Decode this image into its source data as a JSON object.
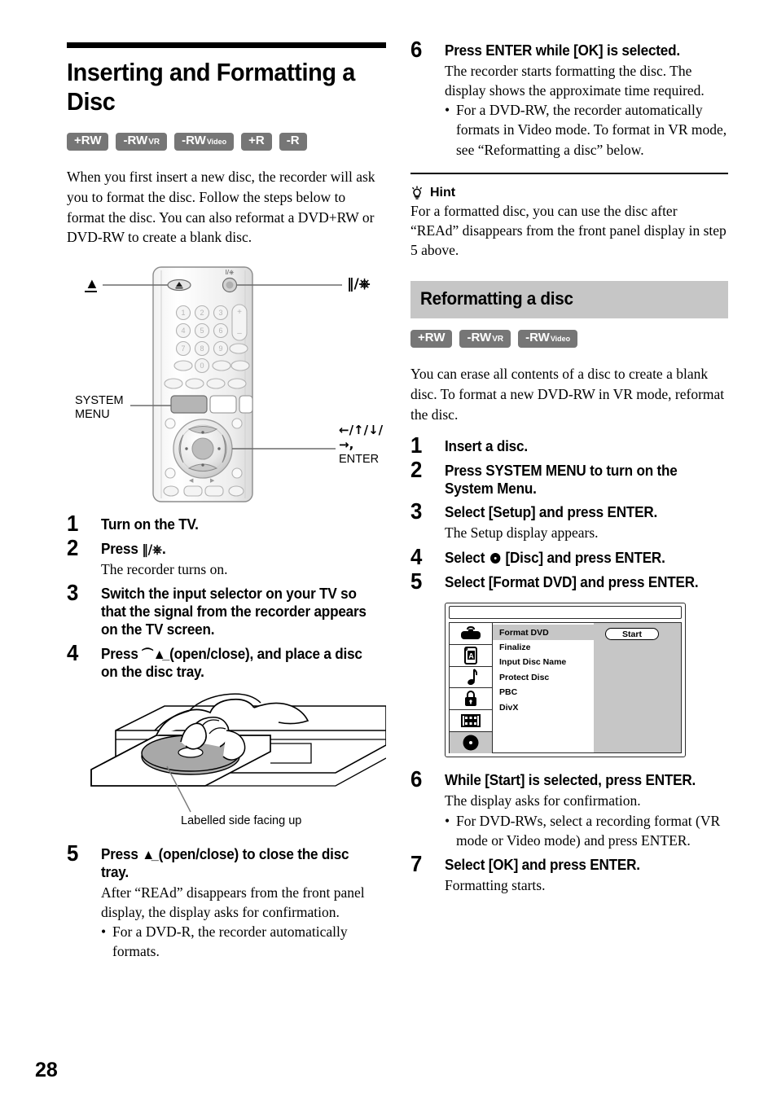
{
  "page": {
    "number": "28"
  },
  "left_column": {
    "title": "Inserting and Formatting a Disc",
    "disc_badges": [
      {
        "main": "+RW",
        "sub": ""
      },
      {
        "main": "-RW",
        "sub": "VR"
      },
      {
        "main": "-RW",
        "sub": "Video"
      },
      {
        "main": "+R",
        "sub": ""
      },
      {
        "main": "-R",
        "sub": ""
      }
    ],
    "intro": "When you first insert a new disc, the recorder will ask you to format the disc. Follow the steps below to format the disc. You can also reformat a DVD+RW or DVD-RW to create a blank disc.",
    "remote_callouts": {
      "eject": "⏏",
      "power": "Ⅱ/⏻",
      "system_menu": "SYSTEM\nMENU",
      "system_menu_line1": "SYSTEM",
      "system_menu_line2": "MENU",
      "direction": "←/↑/↓/→,",
      "enter": "ENTER"
    },
    "steps": [
      {
        "number": "1",
        "head_pre": "Turn on the TV.",
        "head_post": "",
        "desc": "",
        "bullets": []
      },
      {
        "number": "2",
        "head_pre": "Press ",
        "head_post": ".",
        "desc": "The recorder turns on.",
        "bullets": []
      },
      {
        "number": "3",
        "head_pre": "Switch the input selector on your TV so that the signal from the recorder appears on the TV screen.",
        "head_post": "",
        "desc": "",
        "bullets": []
      },
      {
        "number": "4",
        "head_pre": "Press ",
        "head_post": " (open/close), and place a disc on the disc tray.",
        "desc": "",
        "bullets": []
      },
      {
        "number": "5",
        "head_pre": "Press ",
        "head_post": " (open/close) to close the disc tray.",
        "desc": "After “REAd” disappears from the front panel display, the display asks for confirmation.",
        "bullets": [
          "For a DVD-R, the recorder automatically formats."
        ]
      }
    ],
    "tray_caption": "Labelled side facing up"
  },
  "right_column": {
    "step6": {
      "number": "6",
      "head": "Press ENTER while [OK] is selected.",
      "desc": "The recorder starts formatting the disc. The display shows the approximate time required.",
      "bullets": [
        "For a DVD-RW, the recorder automatically formats in Video mode. To format in VR mode, see “Reformatting a disc” below."
      ]
    },
    "hint": {
      "icon": "lightbulb-icon",
      "label": "Hint",
      "body": "For a formatted disc, you can use the disc after “REAd” disappears from the front panel display in step 5 above."
    },
    "section": {
      "title": "Reformatting a disc",
      "disc_badges": [
        {
          "main": "+RW",
          "sub": ""
        },
        {
          "main": "-RW",
          "sub": "VR"
        },
        {
          "main": "-RW",
          "sub": "Video"
        }
      ],
      "intro": "You can erase all contents of a disc to create a blank disc. To format a new DVD-RW in VR mode, reformat the disc."
    },
    "steps": [
      {
        "number": "1",
        "head_pre": "Insert a disc.",
        "head_post": "",
        "desc": "",
        "bullets": []
      },
      {
        "number": "2",
        "head_pre": "Press SYSTEM MENU to turn on the System Menu.",
        "head_post": "",
        "desc": "",
        "bullets": []
      },
      {
        "number": "3",
        "head_pre": "Select [Setup] and press ENTER.",
        "head_post": "",
        "desc": "The Setup display appears.",
        "bullets": []
      },
      {
        "number": "4",
        "head_pre": "Select ",
        "head_post": " [Disc] and press ENTER.",
        "desc": "",
        "bullets": []
      },
      {
        "number": "5",
        "head_pre": "Select [Format DVD] and press ENTER.",
        "head_post": "",
        "desc": "",
        "bullets": []
      }
    ],
    "setup_screen": {
      "sidebar_icons": [
        "toolbox-icon",
        "language-book-icon",
        "music-note-icon",
        "lock-icon",
        "film-strip-icon",
        "disc-icon"
      ],
      "menu_items": [
        "Format DVD",
        "Finalize",
        "Input Disc Name",
        "Protect Disc",
        "PBC",
        "DivX"
      ],
      "selected_item": "Format DVD",
      "action_button": "Start"
    },
    "steps_tail": [
      {
        "number": "6",
        "head_pre": "While [Start] is selected, press ENTER.",
        "head_post": "",
        "desc": "The display asks for confirmation.",
        "bullets": [
          "For DVD-RWs, select a recording format (VR mode or Video mode) and press ENTER."
        ]
      },
      {
        "number": "7",
        "head_pre": "Select [OK] and press ENTER.",
        "head_post": "",
        "desc": "Formatting starts.",
        "bullets": []
      }
    ]
  },
  "colors": {
    "badge_gray": "#767676",
    "section_bar_gray": "#c6c6c6",
    "menu_selected_gray": "#c6c6c6"
  }
}
